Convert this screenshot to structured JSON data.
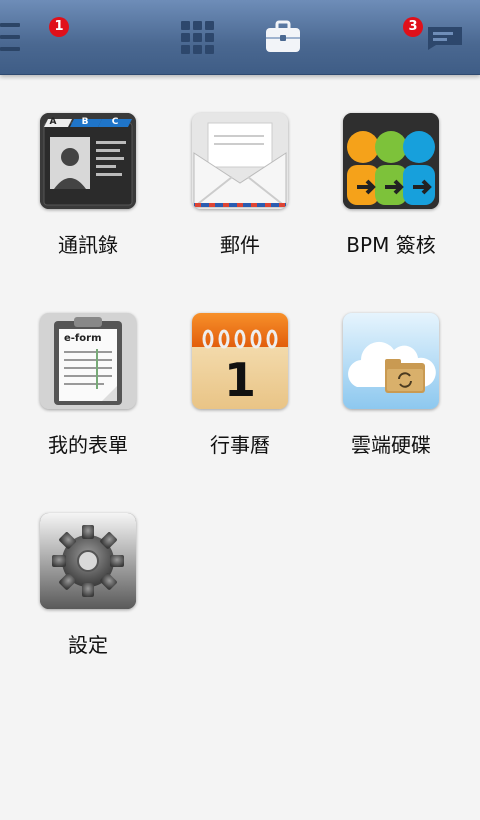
{
  "header": {
    "badge_left": "1",
    "badge_right": "3",
    "icons": [
      "menu-icon",
      "app-grid-icon",
      "briefcase-icon",
      "message-icon"
    ]
  },
  "apps": [
    {
      "label": "通訊錄",
      "icon": "address-book-icon",
      "tabs": [
        "A",
        "B",
        "C"
      ]
    },
    {
      "label": "郵件",
      "icon": "mail-envelope-icon"
    },
    {
      "label": "BPM 簽核",
      "icon": "bpm-flow-icon"
    },
    {
      "label": "我的表單",
      "icon": "e-form-clipboard-icon",
      "icon_text": "e-form"
    },
    {
      "label": "行事曆",
      "icon": "calendar-icon",
      "icon_text": "1"
    },
    {
      "label": "雲端硬碟",
      "icon": "cloud-drive-icon"
    },
    {
      "label": "設定",
      "icon": "settings-gear-icon"
    }
  ],
  "colors": {
    "topbar": "#4a6891",
    "badge": "#e0101a",
    "background": "#f4f4f4"
  }
}
